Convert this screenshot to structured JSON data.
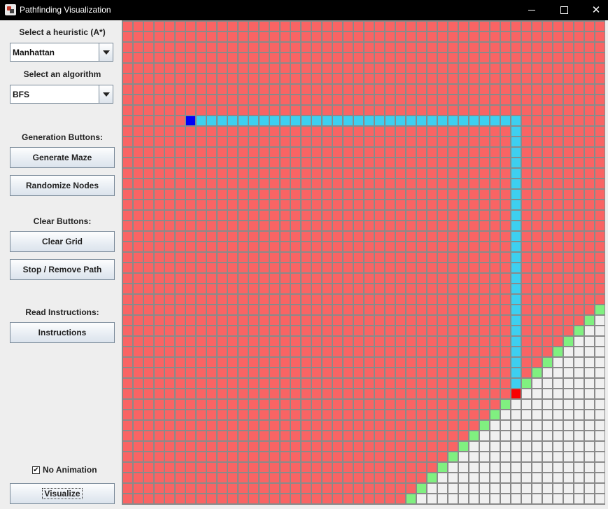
{
  "window": {
    "title": "Pathfinding Visualization"
  },
  "sidebar": {
    "heuristic_label": "Select a heuristic (A*)",
    "heuristic_value": "Manhattan",
    "algorithm_label": "Select an algorithm",
    "algorithm_value": "BFS",
    "generation_label": "Generation Buttons:",
    "generate_maze": "Generate Maze",
    "randomize_nodes": "Randomize Nodes",
    "clear_label": "Clear Buttons:",
    "clear_grid": "Clear Grid",
    "stop_remove_path": "Stop / Remove Path",
    "read_label": "Read Instructions:",
    "instructions": "Instructions",
    "no_animation_label": "No Animation",
    "no_animation_checked": true,
    "visualize": "Visualize"
  },
  "grid": {
    "rows": 46,
    "cols": 46,
    "colors": {
      "visited": "#f96464",
      "path": "#3dd0f0",
      "start": "#0000f8",
      "end": "#f80000",
      "frontier": "#80f080",
      "unvisited": "#f0f0f0",
      "line": "#8a8a8a"
    },
    "start_node": {
      "row": 9,
      "col": 6
    },
    "end_node": {
      "row": 35,
      "col": 37
    },
    "path_corner": {
      "row": 9,
      "col": 37
    },
    "frontier_diagonal_sum": 72
  }
}
